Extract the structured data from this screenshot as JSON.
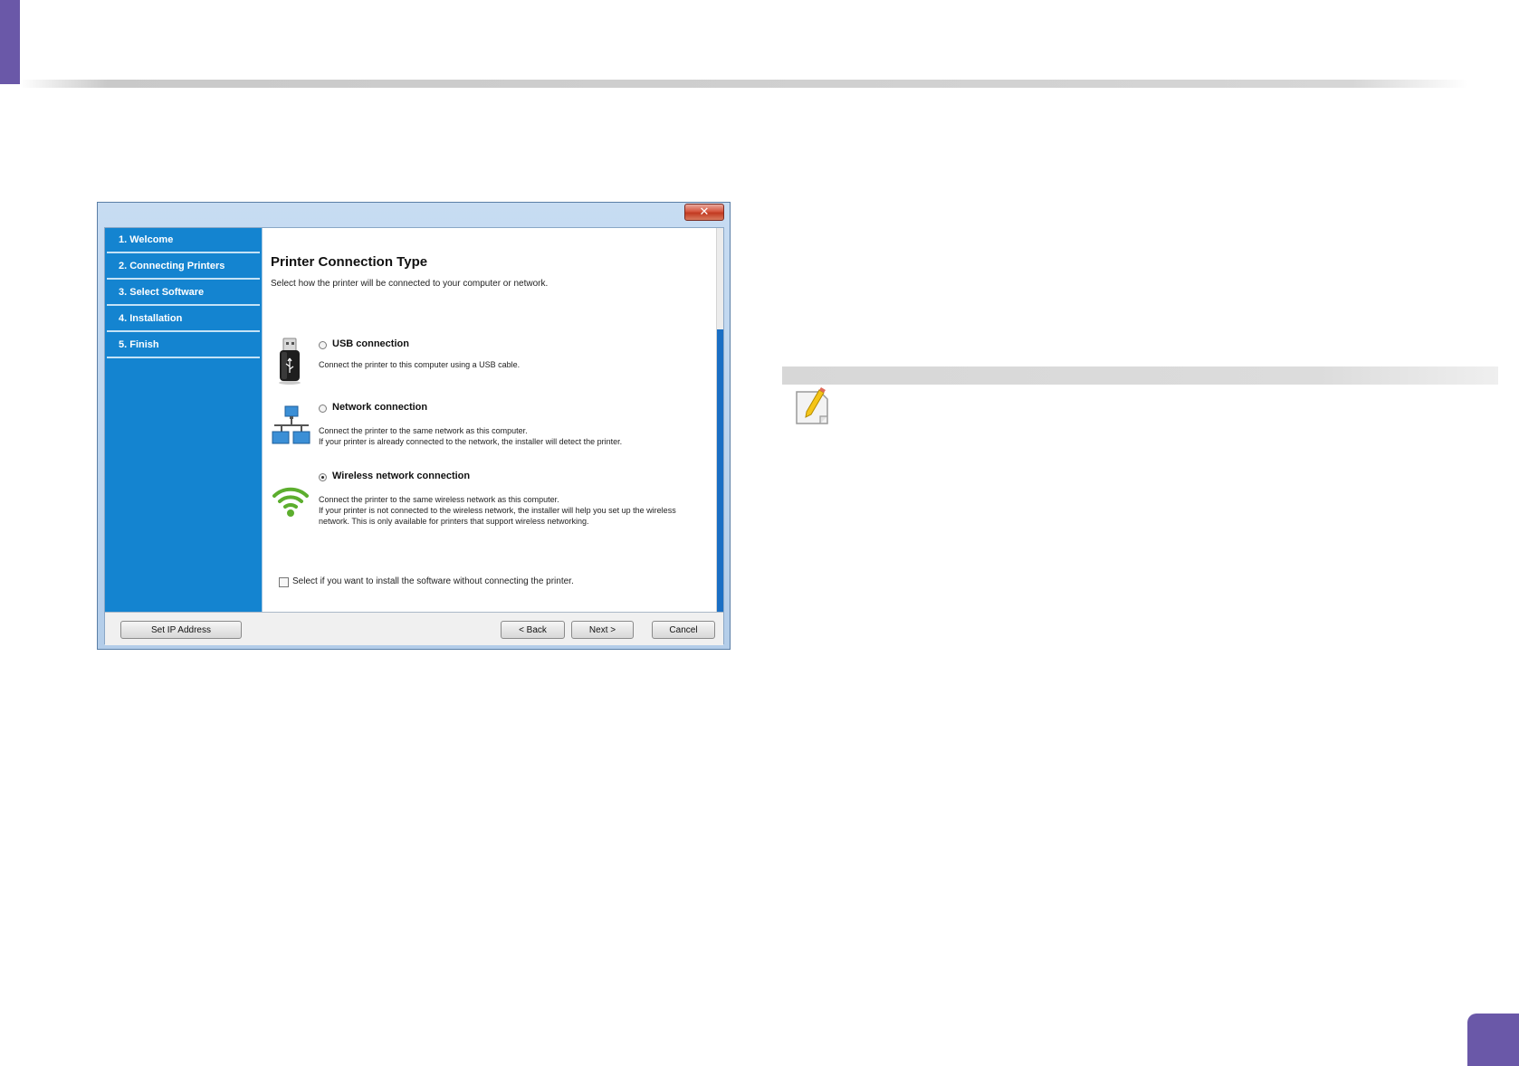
{
  "dialog": {
    "close_symbol": "✕",
    "sidebar": {
      "items": [
        {
          "label": "1. Welcome"
        },
        {
          "label": "2. Connecting Printers"
        },
        {
          "label": "3. Select Software"
        },
        {
          "label": "4. Installation"
        },
        {
          "label": "5. Finish"
        }
      ]
    },
    "title": "Printer Connection Type",
    "subtitle": "Select how the printer will be connected to your computer or network.",
    "options": [
      {
        "icon": "usb-icon",
        "label": "USB connection",
        "desc": [
          "Connect the printer to this computer using a USB cable."
        ],
        "selected": false
      },
      {
        "icon": "network-icon",
        "label": "Network connection",
        "desc": [
          "Connect the printer to the same network as this computer.",
          "If your printer is already connected to the network, the installer will detect the printer."
        ],
        "selected": false
      },
      {
        "icon": "wireless-icon",
        "label": "Wireless network connection",
        "desc": [
          "Connect the printer to the same wireless network as this computer.",
          "If your printer is not connected to the wireless network, the installer will help you set up the wireless",
          "network. This is only available for printers that support wireless networking."
        ],
        "selected": true
      }
    ],
    "checkbox_label": "Select if you want to install the software without connecting the printer.",
    "checkbox_checked": false,
    "buttons": {
      "set_ip": "Set IP Address",
      "back": "< Back",
      "next": "Next >",
      "cancel": "Cancel"
    }
  },
  "colors": {
    "accent": "#6a58a8",
    "sidebar": "#1484d0",
    "wifi_green": "#5cae2e"
  }
}
